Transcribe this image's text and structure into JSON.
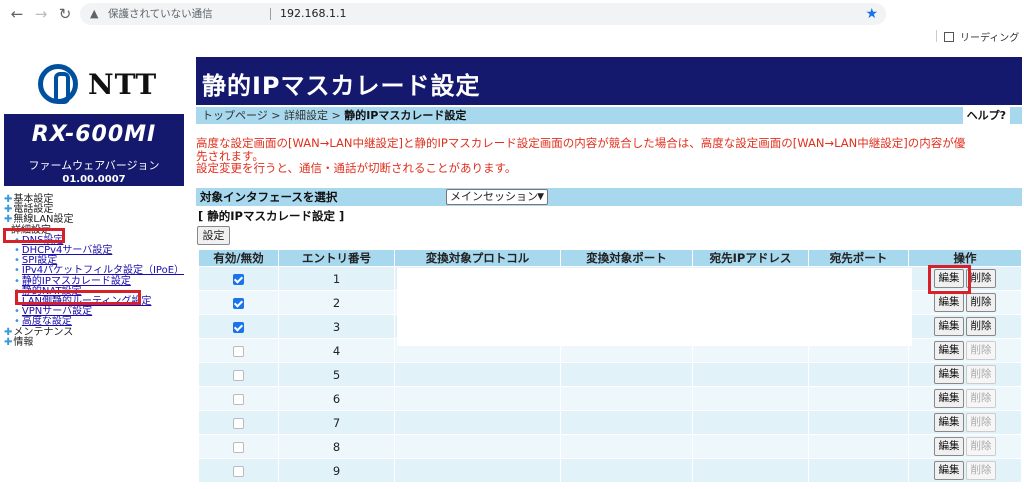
{
  "browser": {
    "security_label": "保護されていない通信",
    "url": "192.168.1.1",
    "reading_list": "リーディング リス"
  },
  "brand": {
    "logo_text": "NTT",
    "model": "RX-600MI",
    "fw_label": "ファームウェアバージョン",
    "fw_version": "01.00.0007"
  },
  "menu": {
    "top1": "基本設定",
    "top2": "電話設定",
    "top3": "無線LAN設定",
    "top4": "詳細設定",
    "sub": [
      "DNS設定",
      "DHCPv4サーバ設定",
      "SPI設定",
      "IPv4パケットフィルタ設定（IPoE）",
      "静的IPマスカレード設定",
      "静的NAT設定",
      "LAN側静的ルーティング設定",
      "VPNサーバ設定",
      "高度な設定"
    ],
    "top5": "メンテナンス",
    "top6": "情報"
  },
  "page": {
    "title": "静的IPマスカレード設定",
    "crumb1": "トップページ",
    "crumb2": "詳細設定",
    "crumb3": "静的IPマスカレード設定",
    "sep": ">",
    "help": "ヘルプ?",
    "warning1": "高度な設定画面の[WAN→LAN中継設定]と静的IPマスカレード設定画面の内容が競合した場合は、高度な設定画面の[WAN→LAN中継設定]の内容が優",
    "warning2": "先されます。",
    "warning3": "設定変更を行うと、通信・通話が切断されることがあります。",
    "iface_label": "対象インタフェースを選択",
    "iface_value": "メインセッション",
    "section_title": "[ 静的IPマスカレード設定 ]",
    "set_button": "設定"
  },
  "table": {
    "headers": [
      "有効/無効",
      "エントリ番号",
      "変換対象プロトコル",
      "変換対象ポート",
      "宛先IPアドレス",
      "宛先ポート",
      "操作"
    ],
    "edit_label": "編集",
    "delete_label": "削除",
    "rows": [
      {
        "num": "1",
        "enabled": true
      },
      {
        "num": "2",
        "enabled": true
      },
      {
        "num": "3",
        "enabled": true
      },
      {
        "num": "4",
        "enabled": false
      },
      {
        "num": "5",
        "enabled": false
      },
      {
        "num": "6",
        "enabled": false
      },
      {
        "num": "7",
        "enabled": false
      },
      {
        "num": "8",
        "enabled": false
      },
      {
        "num": "9",
        "enabled": false
      }
    ]
  }
}
